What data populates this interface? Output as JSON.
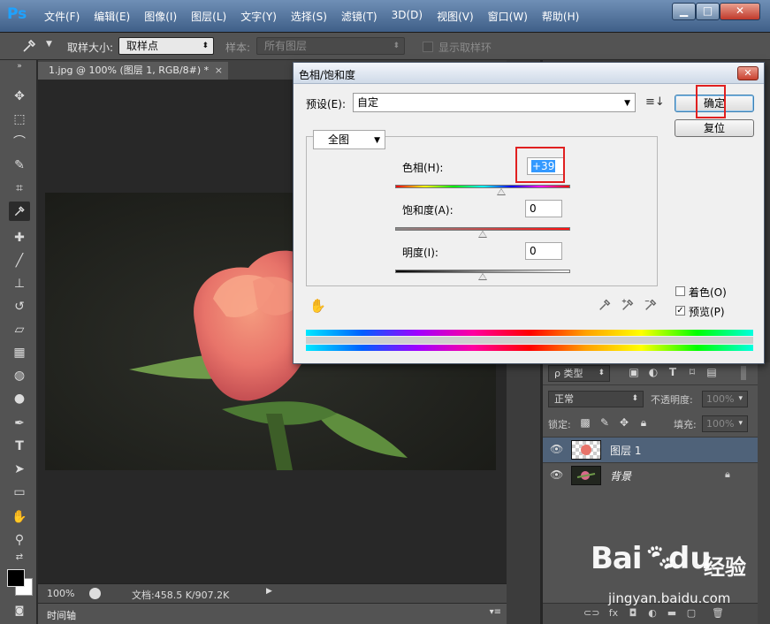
{
  "app": {
    "logo": "Ps",
    "menu": [
      "文件(F)",
      "编辑(E)",
      "图像(I)",
      "图层(L)",
      "文字(Y)",
      "选择(S)",
      "滤镜(T)",
      "3D(D)",
      "视图(V)",
      "窗口(W)",
      "帮助(H)"
    ],
    "window_buttons": {
      "minimize": "▁",
      "maximize": "□",
      "close": "✕"
    }
  },
  "options_bar": {
    "tool_icon": "eyedropper-icon",
    "sample_size_label": "取样大小:",
    "sample_size_value": "取样点",
    "sample_label": "样本:",
    "sample_value": "所有图层",
    "show_ring_label": "显示取样环",
    "show_ring_checked": false
  },
  "document": {
    "tab_title": "1.jpg @ 100% (图层 1, RGB/8#) *",
    "tab_close": "×",
    "zoom": "100%",
    "doc_size": "文档:458.5 K/907.2K",
    "status_arrow": "▶",
    "timeline_label": "时间轴",
    "timeline_menu": "▾≡"
  },
  "dialog": {
    "title": "色相/饱和度",
    "close": "✕",
    "preset_label": "预设(E):",
    "preset_value": "自定",
    "channel_value": "全图",
    "hue_label": "色相(H):",
    "hue_value": "+39",
    "hue_fraction": 0.608,
    "saturation_label": "饱和度(A):",
    "saturation_value": "0",
    "saturation_fraction": 0.5,
    "lightness_label": "明度(I):",
    "lightness_value": "0",
    "lightness_fraction": 0.5,
    "ok_label": "确定",
    "reset_label": "复位",
    "colorize_label": "着色(O)",
    "colorize_checked": false,
    "preview_label": "预览(P)",
    "preview_checked": true,
    "check_mark": "✓"
  },
  "layers_panel": {
    "filter_label": "ρ 类型",
    "blend_mode": "正常",
    "opacity_label": "不透明度:",
    "opacity_value": "100%",
    "lock_label": "锁定:",
    "fill_label": "填充:",
    "fill_value": "100%",
    "layers": [
      {
        "name": "图层 1",
        "selected": true
      },
      {
        "name": "背景",
        "selected": false,
        "locked": true
      }
    ]
  },
  "watermark": {
    "brand": "Bai",
    "brand_suffix": "du",
    "product": "经验",
    "url": "jingyan.baidu.com"
  },
  "colors": {
    "annotation": "#e02020",
    "selected_layer": "#4f6279",
    "ps_blue": "#1ea2ff"
  }
}
